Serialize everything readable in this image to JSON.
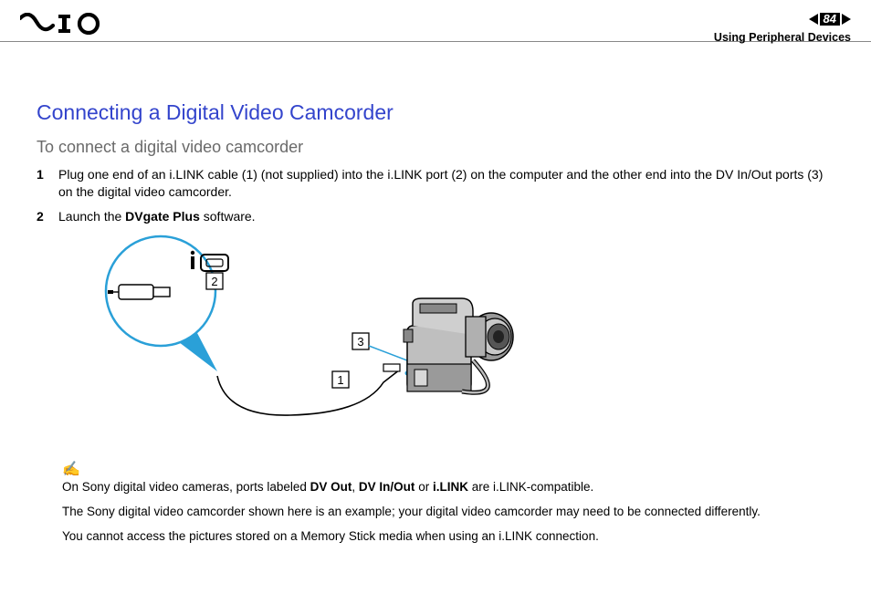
{
  "header": {
    "page_number": "84",
    "section": "Using Peripheral Devices"
  },
  "content": {
    "title": "Connecting a Digital Video Camcorder",
    "subtitle": "To connect a digital video camcorder",
    "steps": [
      {
        "num": "1",
        "text": "Plug one end of an i.LINK cable (1) (not supplied) into the i.LINK port (2) on the computer and the other end into the DV In/Out ports (3) on the digital video camcorder."
      },
      {
        "num": "2",
        "pre": "Launch the ",
        "bold": "DVgate Plus",
        "post": " software."
      }
    ],
    "figure": {
      "callouts": [
        "1",
        "2",
        "3"
      ],
      "description": "i.LINK cable connecting computer i.LINK port to camcorder DV In/Out port"
    },
    "notes": [
      {
        "pre": "On Sony digital video cameras, ports labeled ",
        "b1": "DV Out",
        "b2": "DV In/Out",
        "mid": " or ",
        "b3": "i.LINK",
        "post": " are i.LINK-compatible."
      },
      {
        "text": "The Sony digital video camcorder shown here is an example; your digital video camcorder may need to be connected differently."
      },
      {
        "text": "You cannot access the pictures stored on a Memory Stick media when using an i.LINK connection."
      }
    ]
  }
}
